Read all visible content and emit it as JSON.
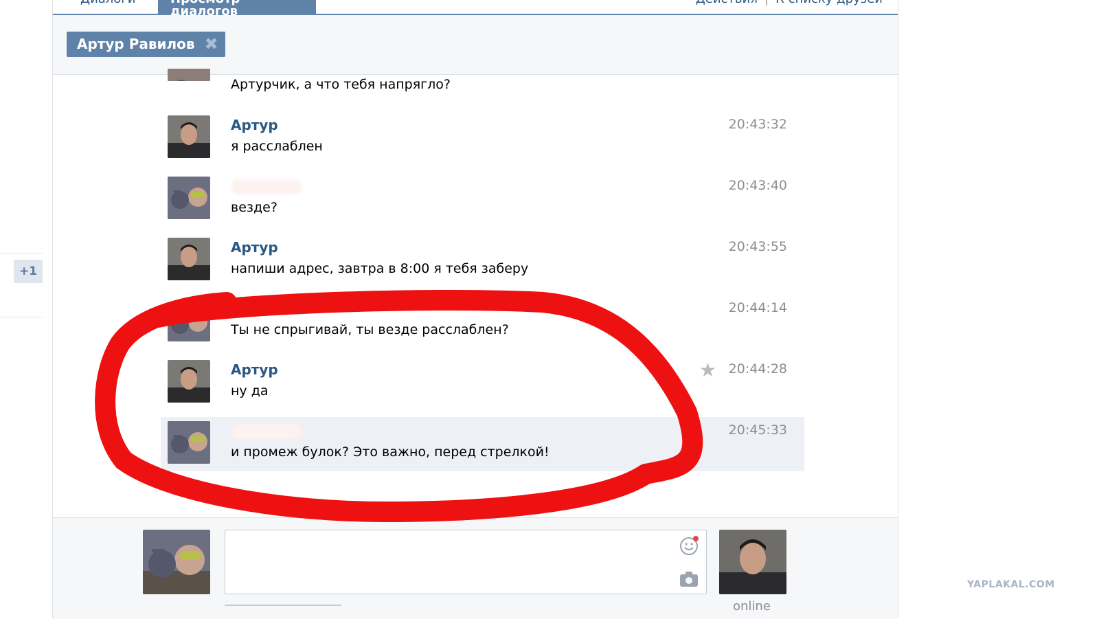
{
  "tabs": {
    "dialogs": "Диалоги",
    "view": "Просмотр диалогов"
  },
  "actions": {
    "actions_label": "Действия",
    "separator": "|",
    "friends_link": "К списку друзей"
  },
  "filter": {
    "chip_label": "Артур Равилов",
    "chip_close": "✖"
  },
  "sidebar": {
    "counter": "+1"
  },
  "messages": [
    {
      "author": "",
      "text": "Артурчик, а что тебя напрягло?",
      "time": ""
    },
    {
      "author": "Артур",
      "text": "я расслаблен",
      "time": "20:43:32"
    },
    {
      "author": "",
      "text": "везде?",
      "time": "20:43:40"
    },
    {
      "author": "Артур",
      "text": "напиши адрес, завтра в 8:00 я тебя заберу",
      "time": "20:43:55"
    },
    {
      "author": "",
      "text": "Ты не спрыгивай, ты везде расслаблен?",
      "time": "20:44:14"
    },
    {
      "author": "Артур",
      "text": "ну да",
      "time": "20:44:28"
    },
    {
      "author": "",
      "text": "и промеж булок? Это важно, перед стрелкой!",
      "time": "20:45:33"
    }
  ],
  "composer": {
    "status": "online",
    "placeholder": ""
  },
  "icons": {
    "check": "check-icon",
    "star": "star-icon",
    "smile": "smile-icon",
    "camera": "camera-icon",
    "close": "close-icon"
  },
  "colors": {
    "accent": "#5e82a8",
    "link": "#2a5885",
    "highlight": "#edf0f5",
    "annotation_red": "#ee1111",
    "time_gray": "#8a8d91"
  },
  "watermark": "YAPLAKAL.COM"
}
